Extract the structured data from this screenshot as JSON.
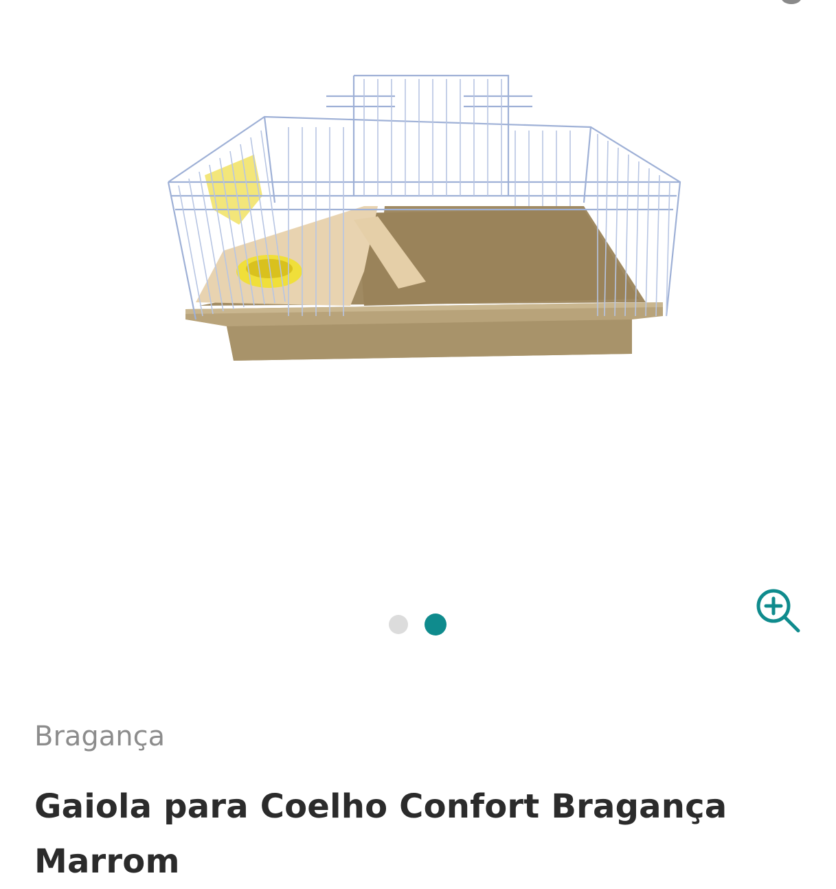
{
  "gallery": {
    "image_alt": "Gaiola para Coelho Confort Bragança Marrom",
    "slide_count": 2,
    "active_slide": 2,
    "zoom_icon": "zoom-in-icon",
    "colors": {
      "accent": "#0f8b8d",
      "dot_inactive": "#dcdcdc"
    }
  },
  "product": {
    "brand": "Bragança",
    "title": "Gaiola para Coelho Confort Bragança Marrom"
  }
}
